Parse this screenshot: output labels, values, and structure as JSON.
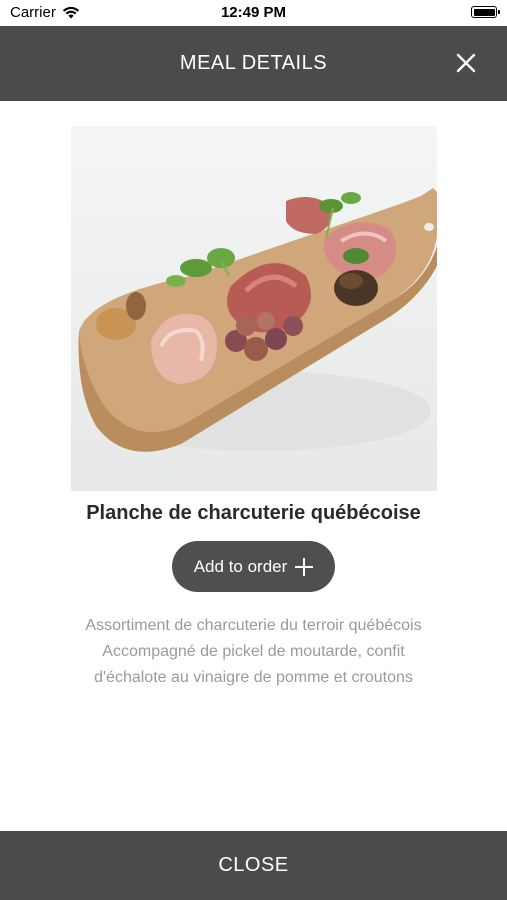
{
  "status_bar": {
    "carrier": "Carrier",
    "time": "12:49 PM"
  },
  "header": {
    "title": "MEAL DETAILS"
  },
  "meal": {
    "name": "Planche de charcuterie québécoise",
    "add_button_label": "Add to order",
    "description_lines": [
      "Assortiment de charcuterie du terroir québécois",
      "Accompagné de pickel de moutarde, confit",
      "d'échalote au vinaigre de pomme et croutons"
    ]
  },
  "footer": {
    "close_label": "CLOSE"
  },
  "colors": {
    "header_bg": "#4b4b4b",
    "button_bg": "#4f4f4f",
    "description_text": "#9a9a9a"
  }
}
